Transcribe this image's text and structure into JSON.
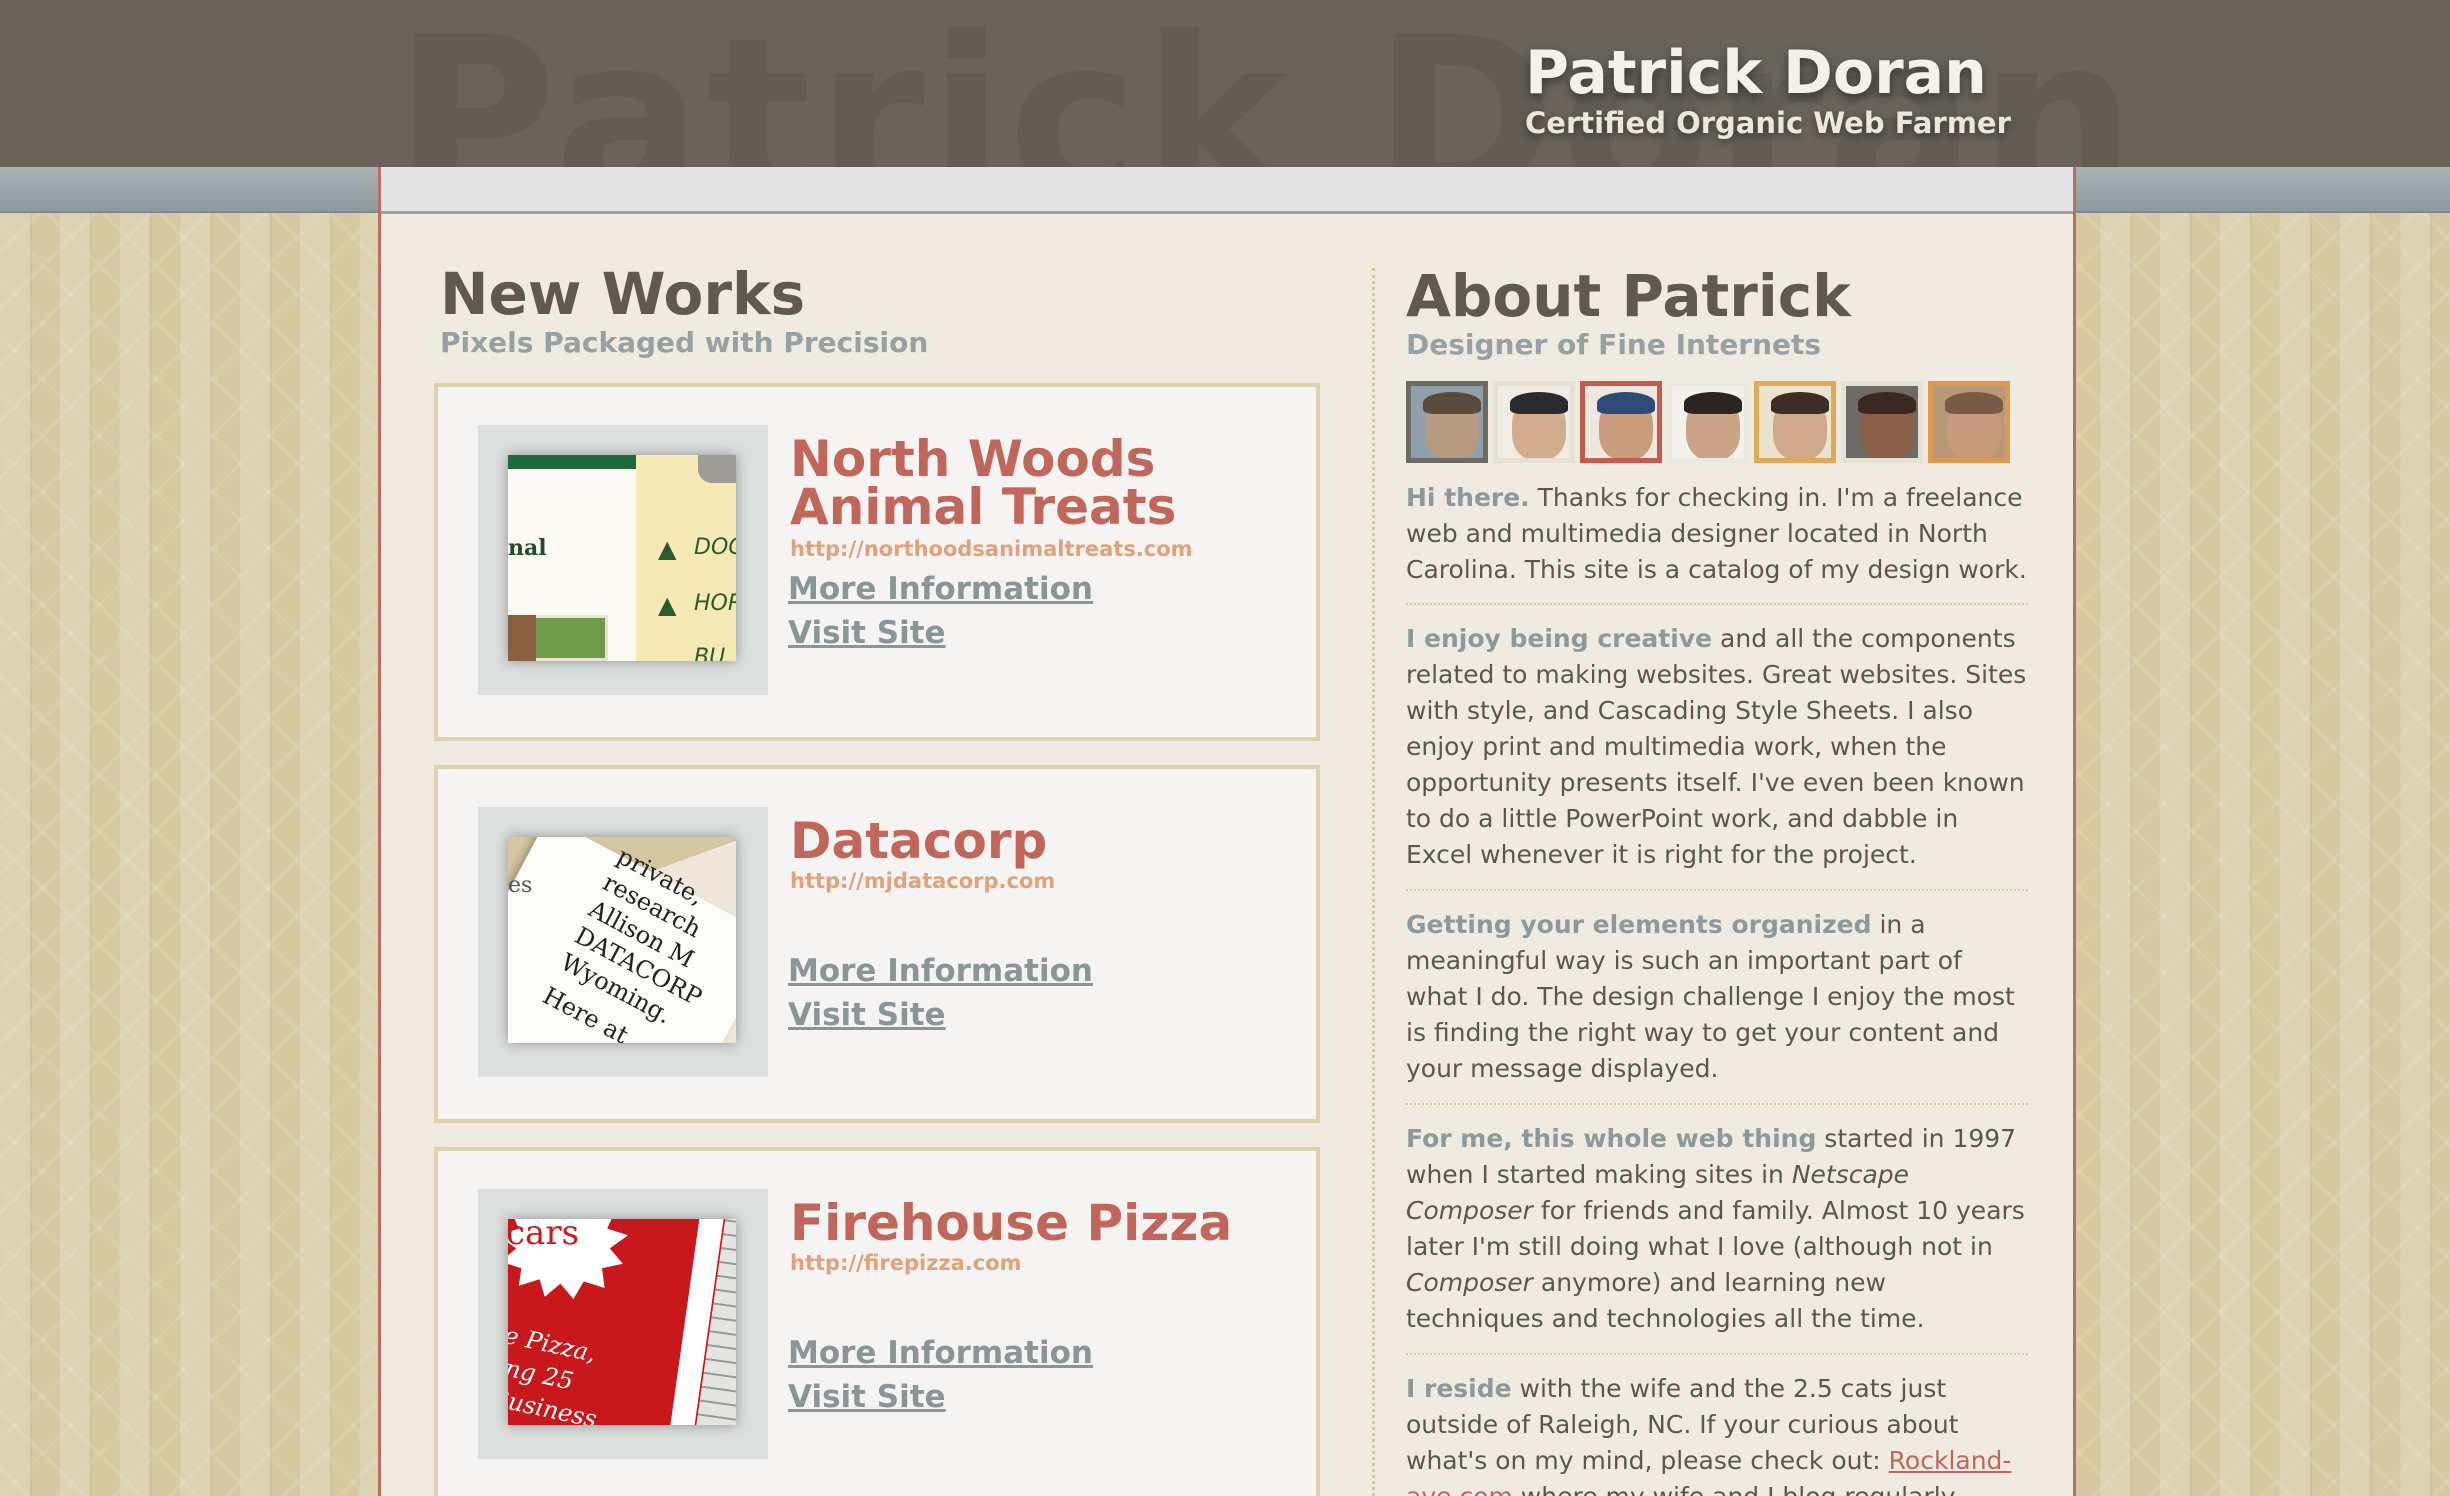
{
  "header": {
    "name": "Patrick Doran",
    "tagline": "Certified Organic Web Farmer",
    "watermark": "Patrick Doran"
  },
  "new_works": {
    "title": "New Works",
    "subtitle": "Pixels Packaged with Precision",
    "items": [
      {
        "title_line1": "North Woods",
        "title_line2": "Animal Treats",
        "url": "http://northoodsanimaltreats.com",
        "more_info_label": "More Information",
        "visit_label": "Visit Site",
        "thumb_texts": [
          "nal",
          "DOG",
          "HOR",
          "BU"
        ]
      },
      {
        "title_line1": "Datacorp",
        "title_line2": "",
        "url": "http://mjdatacorp.com",
        "more_info_label": "More Information",
        "visit_label": "Visit Site",
        "thumb_texts": [
          "private,",
          "research",
          "Allison M",
          "DATACORP",
          "Wyoming.",
          "Here at",
          "es"
        ]
      },
      {
        "title_line1": "Firehouse Pizza",
        "title_line2": "",
        "url": "http://firepizza.com",
        "more_info_label": "More Information",
        "visit_label": "Visit Site",
        "thumb_texts": [
          "cars",
          "e Pizza,",
          "ing 25",
          "Business"
        ]
      }
    ]
  },
  "about": {
    "title": "About Patrick",
    "subtitle": "Designer of Fine Internets",
    "avatars": [
      {
        "frame": "#6d6a64",
        "face": "#b79a82",
        "hair": "#5a4a3c",
        "bg": "#8fa0ab"
      },
      {
        "frame": "#e6e1d2",
        "face": "#d1ac8d",
        "hair": "#2b2a2e",
        "bg": "#f0ece3"
      },
      {
        "frame": "#c65b4d",
        "face": "#c99c7d",
        "hair": "#2f4a7a",
        "bg": "#ece8e0"
      },
      {
        "frame": "#ece9e1",
        "face": "#c9a489",
        "hair": "#2c2420",
        "bg": "#f3f1ec"
      },
      {
        "frame": "#dfa958",
        "face": "#d0a88a",
        "hair": "#3a2e25",
        "bg": "#e9e2cf"
      },
      {
        "frame": "#e6e1d2",
        "face": "#8a5f48",
        "hair": "#3b2820",
        "bg": "#6e6a66"
      },
      {
        "frame": "#dd9a4f",
        "face": "#c79a7e",
        "hair": "#7a5a44",
        "bg": "#b79979"
      }
    ],
    "paragraphs": [
      {
        "lead": "Hi there.",
        "text": " Thanks for checking in. I'm a freelance web and multimedia designer located in North Carolina. This site is a catalog of my design work."
      },
      {
        "lead": "I enjoy being creative",
        "text": " and all the components related to making websites. Great websites. Sites with style, and Cascading Style Sheets. I also enjoy print and multimedia work, when the opportunity presents itself. I've even been known to do a little PowerPoint work, and dabble in Excel whenever it is right for the project."
      },
      {
        "lead": "Getting your elements organized",
        "text": " in a meaningful way is such an important part of what I do. The design challenge I enjoy the most is finding the right way to get your content and your message displayed."
      },
      {
        "lead": "For me, this whole web thing",
        "text_a": " started in 1997 when I started making sites in ",
        "em_a": "Netscape Composer",
        "text_b": " for friends and family. Almost 10 years later I'm still doing what I love (although not in ",
        "em_b": "Composer",
        "text_c": " anymore) and learning new techniques and technologies all the time."
      },
      {
        "lead": "I reside",
        "text_a": " with the wife and the 2.5 cats just outside of Raleigh, NC. If your curious about what's on my mind, please check out: ",
        "link": "Rockland-ave.com",
        "text_b": " where my wife and I blog regularly."
      }
    ]
  },
  "colors": {
    "accent": "#c0665a",
    "link_gray": "#8a9598",
    "header_bg": "#69645b",
    "panel_bg": "#efebe0"
  }
}
